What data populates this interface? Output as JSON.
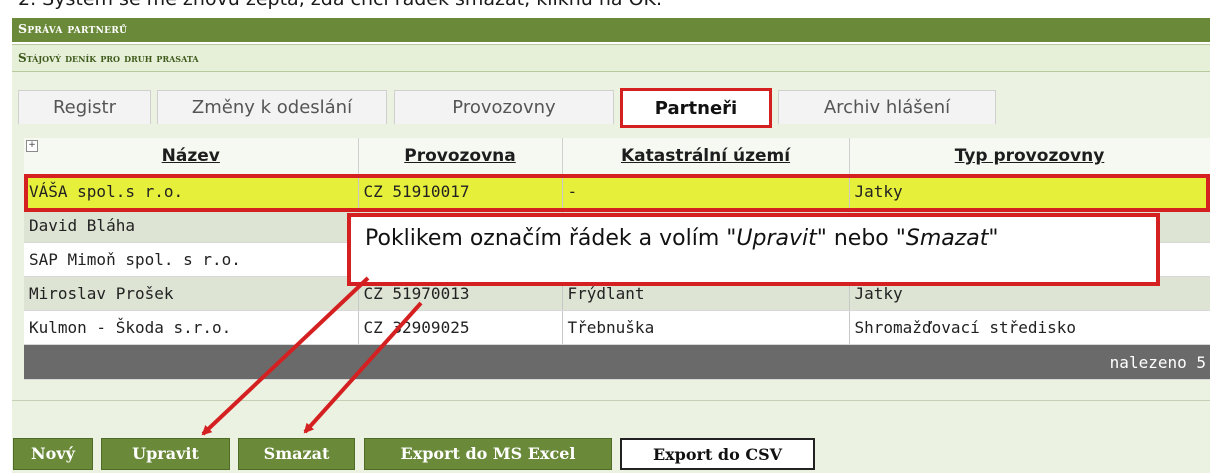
{
  "caption": "2.   Systém se mě znovu zeptá, zda chci řádek smazat, kliknu na OK.",
  "app_title": "Správa partnerů",
  "subtitle": "Stájový deník pro druh prasata",
  "tabs": [
    {
      "label": "Registr",
      "active": false
    },
    {
      "label": "Změny k odeslání",
      "active": false
    },
    {
      "label": "Provozovny",
      "active": false
    },
    {
      "label": "Partneři",
      "active": true
    },
    {
      "label": "Archiv hlášení",
      "active": false
    }
  ],
  "table": {
    "expander_icon": "plus-box-icon",
    "columns": [
      "Název",
      "Provozovna",
      "Katastrální území",
      "Typ provozovny"
    ],
    "rows": [
      {
        "nazev": "VÁŠA spol.s r.o.",
        "provozovna": "CZ 51910017",
        "katastr": "-",
        "typ": "Jatky",
        "selected": true
      },
      {
        "nazev": "David Bláha",
        "provozovna": "",
        "katastr": "",
        "typ": "",
        "selected": false
      },
      {
        "nazev": "SAP Mimoň spol. s r.o.",
        "provozovna": "",
        "katastr": "",
        "typ": "",
        "selected": false
      },
      {
        "nazev": "Miroslav Prošek",
        "provozovna": "CZ 51970013",
        "katastr": "Frýdlant",
        "typ": "Jatky",
        "selected": false
      },
      {
        "nazev": "Kulmon - Škoda s.r.o.",
        "provozovna": "CZ 32909025",
        "katastr": "Třebnuška",
        "typ": "Shromažďovací středisko",
        "selected": false
      }
    ],
    "footer": "nalezeno 5"
  },
  "callout": {
    "before": "Poklikem označím řádek a volím \"",
    "edit": "Upravit",
    "middle": "\" nebo \"",
    "delete": "Smazat",
    "after": "\""
  },
  "buttons": {
    "new": "Nový",
    "edit": "Upravit",
    "delete": "Smazat",
    "export_excel": "Export do MS Excel",
    "export_csv": "Export do CSV"
  },
  "colors": {
    "brand_green": "#6a8a3a",
    "highlight_red": "#d42020",
    "selected_row": "#e6ef3a"
  }
}
